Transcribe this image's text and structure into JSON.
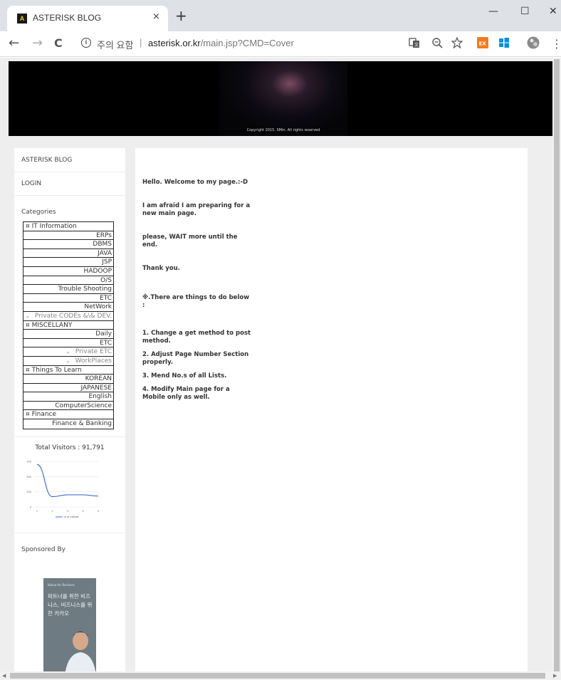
{
  "browser": {
    "tab_title": "ASTERISK BLOG",
    "favicon_letter": "A",
    "close_glyph": "×",
    "newtab_glyph": "+",
    "win_min": "—",
    "win_max": "☐",
    "win_close": "✕",
    "back": "←",
    "forward": "→",
    "reload": "C",
    "info": "i",
    "security_warning": "주의 요함",
    "separator": "|",
    "url_host": "asterisk.or.kr",
    "url_path": "/main.jsp?CMD=Cover",
    "menu_glyph": "⋮"
  },
  "banner": {
    "copyright": "Copyright 2015. SMin. All rights reserved"
  },
  "sidebar": {
    "blog_title": "ASTERISK BLOG",
    "login": "LOGIN",
    "categories_heading": "Categories",
    "categories": [
      {
        "label": "¤ IT Information",
        "kind": "group"
      },
      {
        "label": "ERPs",
        "kind": "item"
      },
      {
        "label": "DBMS",
        "kind": "item"
      },
      {
        "label": "JAVA",
        "kind": "item"
      },
      {
        "label": "JSP",
        "kind": "item"
      },
      {
        "label": "HADOOP",
        "kind": "item"
      },
      {
        "label": "O/S",
        "kind": "item"
      },
      {
        "label": "Trouble Shooting",
        "kind": "item"
      },
      {
        "label": "ETC",
        "kind": "item"
      },
      {
        "label": "NetWork",
        "kind": "item"
      },
      {
        "label": "。 Private CODEs &\\& DEV.",
        "kind": "sub"
      },
      {
        "label": "¤ MISCELLANY",
        "kind": "group"
      },
      {
        "label": "Daily",
        "kind": "item"
      },
      {
        "label": "ETC",
        "kind": "item"
      },
      {
        "label": "。 Private ETC",
        "kind": "sub"
      },
      {
        "label": "。 WorkPlaces",
        "kind": "sub"
      },
      {
        "label": "¤ Things To Learn",
        "kind": "group"
      },
      {
        "label": "KOREAN",
        "kind": "item"
      },
      {
        "label": "JAPANESE",
        "kind": "item"
      },
      {
        "label": "English",
        "kind": "item"
      },
      {
        "label": "ComputerScience",
        "kind": "item"
      },
      {
        "label": "¤ Finance",
        "kind": "group"
      },
      {
        "label": "Finance & Banking",
        "kind": "item"
      }
    ],
    "visitors_text": "Total Visitors : 91,791",
    "sponsored_heading": "Sponsored By",
    "ad_small": "Kakao for Business",
    "ad_text": "파트너를 위한 비즈니스, 비즈니스를 위한 카카오"
  },
  "chart_data": {
    "type": "line",
    "x": [
      1,
      2,
      3,
      4,
      5
    ],
    "series": [
      {
        "name": "# of visited",
        "values": [
          700,
          170,
          200,
          200,
          180
        ]
      }
    ],
    "ylim": [
      0,
      750
    ],
    "yticks": [
      0,
      250,
      500,
      750
    ],
    "legend": "bottom",
    "grid": true,
    "color": "#4472c4"
  },
  "main": {
    "paragraphs": [
      "Hello. Welcome to my page.:-D",
      "I am afraid I am preparing for a new main page.",
      "please, WAIT more until the end.",
      "Thank you.",
      "※.There are things to do below :",
      "1. Change a get method to post method.",
      "2. Adjust Page Number Section properly.",
      "3. Mend No.s of all Lists.",
      "4. Modify Main page for a Mobile only as well."
    ]
  }
}
